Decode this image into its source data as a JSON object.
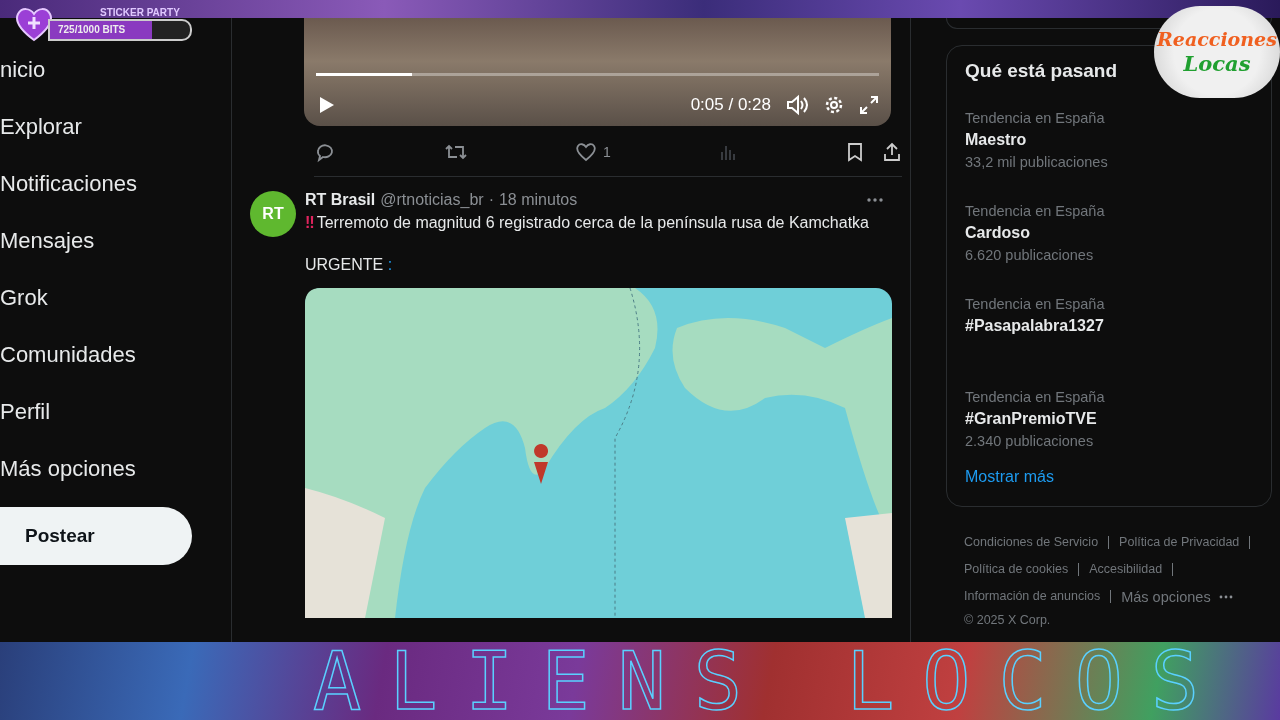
{
  "overlay": {
    "sticker_party": {
      "title": "STICKER PARTY",
      "progress": "725/1000 BITS",
      "level": 0.725
    },
    "logo": {
      "line1": "Reacciones",
      "line2": "Locas"
    },
    "banner": {
      "title": "ALIENS LOCOS"
    }
  },
  "nav": {
    "items": [
      {
        "label": "nicio"
      },
      {
        "label": "Explorar"
      },
      {
        "label": "Notificaciones"
      },
      {
        "label": "Mensajes"
      },
      {
        "label": "Grok"
      },
      {
        "label": "Comunidades"
      },
      {
        "label": "Perfil"
      },
      {
        "label": "Más opciones"
      }
    ],
    "post_button": "Postear"
  },
  "feed": {
    "video_post": {
      "player": {
        "time": "0:05 / 0:28",
        "level": 0.17
      },
      "likes": "1"
    },
    "post": {
      "avatar": "RT",
      "name": "RT Brasil",
      "handle": "@rtnoticias_br",
      "dot": "·",
      "time": "18 minutos",
      "marker": "‼",
      "text": "Terremoto de magnitud 6 registrado cerca de la península rusa de Kamchatka",
      "urgent": "URGENTE",
      "urgent_mark": ":"
    }
  },
  "sidebar": {
    "trends_title": "Qué está pasand",
    "trends": [
      {
        "context": "Tendencia en España",
        "name": "Maestro",
        "count": "33,2 mil publicaciones"
      },
      {
        "context": "Tendencia en España",
        "name": "Cardoso",
        "count": "6.620 publicaciones"
      },
      {
        "context": "Tendencia en España",
        "name": "#Pasapalabra1327"
      },
      {
        "context": "Tendencia en España",
        "name": "#GranPremioTVE",
        "count": "2.340 publicaciones"
      }
    ],
    "show_more": "Mostrar más",
    "footer": {
      "rows": [
        [
          "Condiciones de Servicio",
          "Política de Privacidad"
        ],
        [
          "Política de cookies",
          "Accesibilidad"
        ],
        [
          "Información de anuncios"
        ]
      ],
      "more": "Más opciones",
      "copyright": "© 2025 X Corp."
    }
  }
}
